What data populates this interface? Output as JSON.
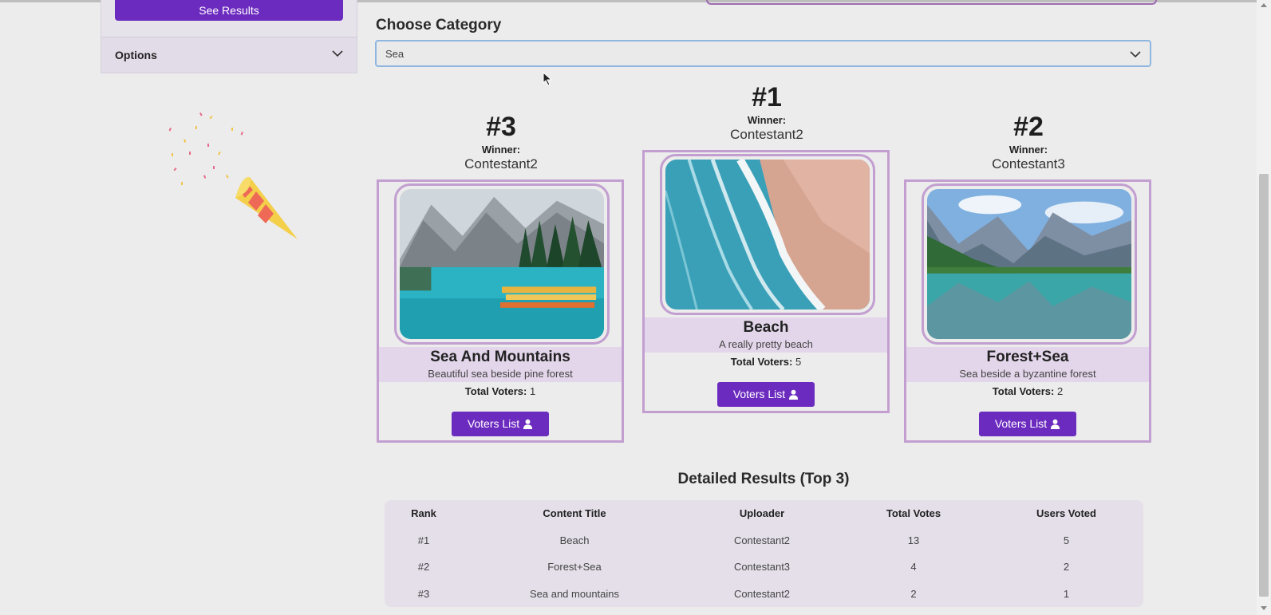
{
  "sidebar": {
    "see_results_label": "See Results",
    "options_label": "Options"
  },
  "category": {
    "title": "Choose Category",
    "selected": "Sea"
  },
  "podium": {
    "first": {
      "rank": "#1",
      "winner_label": "Winner:",
      "winner_name": "Contestant2",
      "title": "Beach",
      "description": "A really pretty beach",
      "total_voters_label": "Total Voters:",
      "total_voters": "5",
      "voters_button": "Voters List"
    },
    "second": {
      "rank": "#2",
      "winner_label": "Winner:",
      "winner_name": "Contestant3",
      "title": "Forest+Sea",
      "description": "Sea beside a byzantine forest",
      "total_voters_label": "Total Voters:",
      "total_voters": "2",
      "voters_button": "Voters List"
    },
    "third": {
      "rank": "#3",
      "winner_label": "Winner:",
      "winner_name": "Contestant2",
      "title": "Sea And Mountains",
      "description": "Beautiful sea beside pine forest",
      "total_voters_label": "Total Voters:",
      "total_voters": "1",
      "voters_button": "Voters List"
    }
  },
  "results": {
    "title": "Detailed Results (Top 3)",
    "headers": [
      "Rank",
      "Content Title",
      "Uploader",
      "Total Votes",
      "Users Voted"
    ],
    "rows": [
      [
        "#1",
        "Beach",
        "Contestant2",
        "13",
        "5"
      ],
      [
        "#2",
        "Forest+Sea",
        "Contestant3",
        "4",
        "2"
      ],
      [
        "#3",
        "Sea and mountains",
        "Contestant2",
        "2",
        "1"
      ]
    ]
  },
  "icons": {
    "options_chevron": "chevron-down-icon",
    "select_chevron": "chevron-down-icon",
    "user": "user-icon",
    "popper": "party-popper-icon"
  },
  "colors": {
    "accent": "#6c2bbf",
    "card_border": "#c29fd0",
    "band": "#e3d6ea"
  }
}
